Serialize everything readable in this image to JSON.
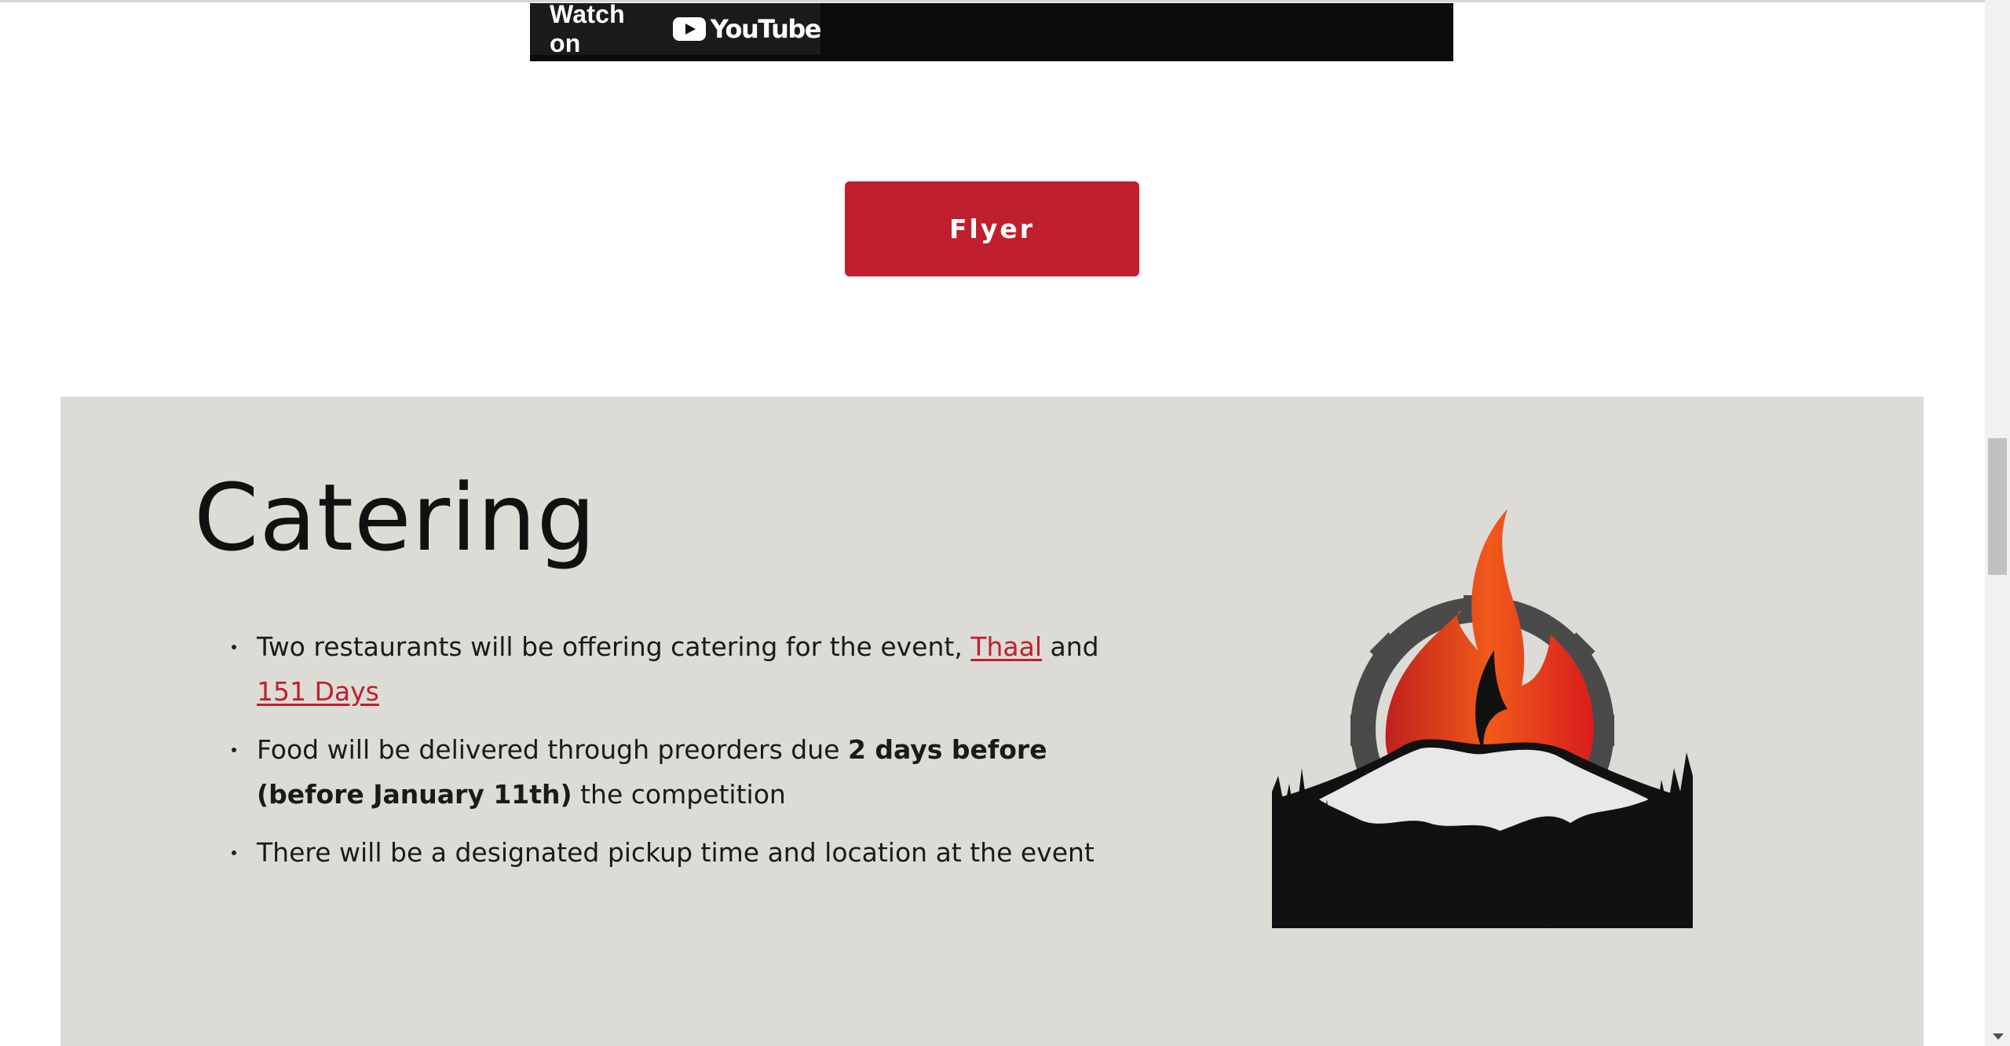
{
  "video": {
    "watch_on": "Watch on",
    "platform": "YouTube"
  },
  "flyer": {
    "label": "Flyer"
  },
  "catering": {
    "title": "Catering",
    "bullets": [
      {
        "pre": "Two restaurants will be offering catering for the event, ",
        "link1": "Thaal",
        "mid": " and ",
        "link2": "151 Days"
      },
      {
        "pre": "Food will be delivered through preorders due ",
        "bold": "2 days before (before January 11th)",
        "post": " the competition"
      },
      {
        "text": "There will be a designated pickup time and location at the event"
      }
    ]
  },
  "colors": {
    "accent": "#c01f2f",
    "section_bg": "#dddbd6"
  },
  "icons": [
    "youtube-logo-icon",
    "flame-mountain-gear-logo"
  ]
}
